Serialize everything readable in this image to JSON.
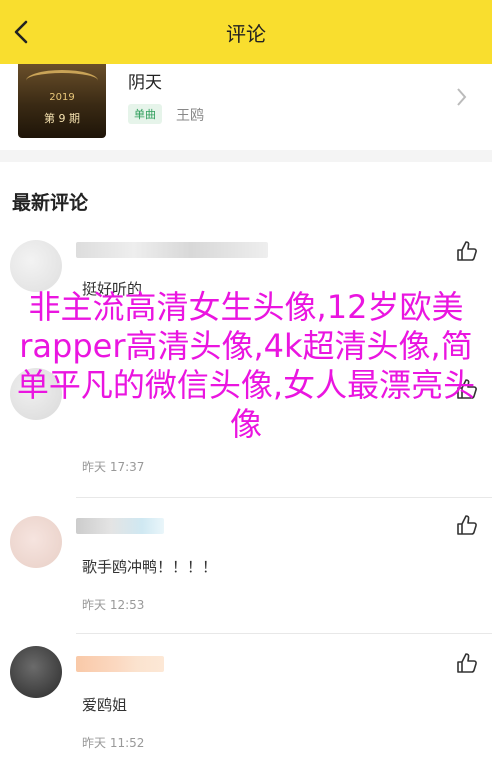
{
  "header": {
    "title": "评论",
    "back_icon": "back-arrow-icon"
  },
  "song": {
    "cover_year": "2019",
    "cover_episode": "第 9 期",
    "title": "阴天",
    "tag": "单曲",
    "artist": "王鸥"
  },
  "section": {
    "title": "最新评论"
  },
  "comments": [
    {
      "text": "挺好听的",
      "time": ""
    },
    {
      "text": "",
      "time": "昨天 17:37"
    },
    {
      "text": "歌手鸥冲鸭！！！！",
      "time": "昨天 12:53"
    },
    {
      "text": "爱鸥姐",
      "time": "昨天 11:52"
    }
  ],
  "overlay": {
    "text": "非主流高清女生头像,12岁欧美rapper高清头像,4k超清头像,简单平凡的微信头像,女人最漂亮头像"
  },
  "colors": {
    "accent": "#f9de2e",
    "overlay": "#ea15e0"
  }
}
